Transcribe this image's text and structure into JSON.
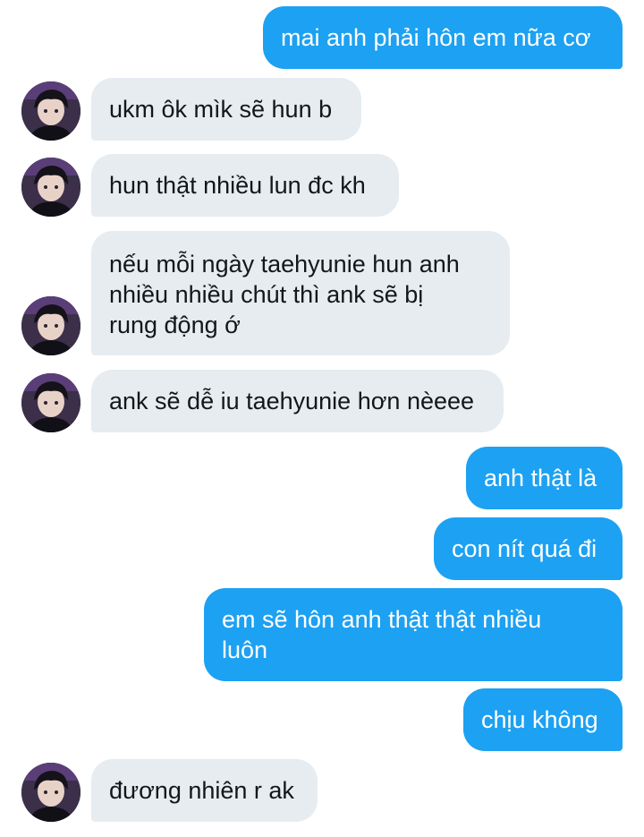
{
  "messages": [
    {
      "from": "me",
      "text": "mai anh phải hôn em nữa cơ"
    },
    {
      "from": "them",
      "text": "ukm ôk mìk sẽ hun b"
    },
    {
      "from": "them",
      "text": "hun thật nhiều lun đc kh"
    },
    {
      "from": "them",
      "text": "nếu mỗi ngày taehyunie hun anh\nnhiều nhiều chút thì ank sẽ bị\nrung động ớ"
    },
    {
      "from": "them",
      "text": "ank sẽ dễ iu taehyunie hơn nèeee"
    },
    {
      "from": "me",
      "text": "anh thật là"
    },
    {
      "from": "me",
      "text": "con nít quá đi"
    },
    {
      "from": "me",
      "text": "em sẽ hôn anh thật thật nhiều\nluôn"
    },
    {
      "from": "me",
      "text": "chịu không"
    },
    {
      "from": "them",
      "text": "đương nhiên r ak"
    }
  ],
  "colors": {
    "outgoing_bubble": "#1da1f2",
    "incoming_bubble": "#e6ecf0",
    "outgoing_text": "#ffffff",
    "incoming_text": "#14171a"
  }
}
